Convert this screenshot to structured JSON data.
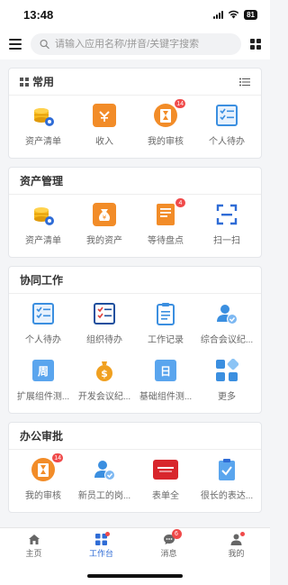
{
  "status_bar": {
    "time": "13:48",
    "battery": "81"
  },
  "search": {
    "placeholder": "请输入应用名称/拼音/关键字搜索"
  },
  "sections": {
    "common": {
      "title": "常用",
      "items": [
        {
          "label": "资产清单",
          "icon": "coins-gear-icon"
        },
        {
          "label": "收入",
          "icon": "income-icon"
        },
        {
          "label": "我的审核",
          "icon": "hourglass-review-icon",
          "badge": "14"
        },
        {
          "label": "个人待办",
          "icon": "todo-list-icon"
        }
      ]
    },
    "assets": {
      "title": "资产管理",
      "items": [
        {
          "label": "资产清单",
          "icon": "coins-gear-icon"
        },
        {
          "label": "我的资产",
          "icon": "money-bag-icon"
        },
        {
          "label": "等待盘点",
          "icon": "document-icon",
          "badge": "4"
        },
        {
          "label": "扫一扫",
          "icon": "scan-icon"
        }
      ]
    },
    "collab": {
      "title": "协同工作",
      "items": [
        {
          "label": "个人待办",
          "icon": "todo-list-icon"
        },
        {
          "label": "组织待办",
          "icon": "checklist-icon"
        },
        {
          "label": "工作记录",
          "icon": "clipboard-icon"
        },
        {
          "label": "综合会议纪...",
          "icon": "user-check-icon"
        },
        {
          "label": "扩展组件测...",
          "icon": "week-icon",
          "glyph": "周"
        },
        {
          "label": "开发会议纪...",
          "icon": "dollar-bag-icon"
        },
        {
          "label": "基础组件测...",
          "icon": "day-icon",
          "glyph": "日"
        },
        {
          "label": "更多",
          "icon": "more-apps-icon"
        }
      ]
    },
    "office": {
      "title": "办公审批",
      "items": [
        {
          "label": "我的审核",
          "icon": "hourglass-review-icon",
          "badge": "14"
        },
        {
          "label": "新员工的岗...",
          "icon": "user-check-icon"
        },
        {
          "label": "表单全",
          "icon": "brand-logo-icon"
        },
        {
          "label": "很长的表达...",
          "icon": "clipboard-check-icon"
        }
      ]
    }
  },
  "tabbar": {
    "home": "主页",
    "workbench": "工作台",
    "messages": "消息",
    "messages_badge": "6",
    "mine": "我的"
  },
  "colors": {
    "accent": "#2f6cd6",
    "orange": "#f28c28",
    "badge": "#f04a4a"
  }
}
